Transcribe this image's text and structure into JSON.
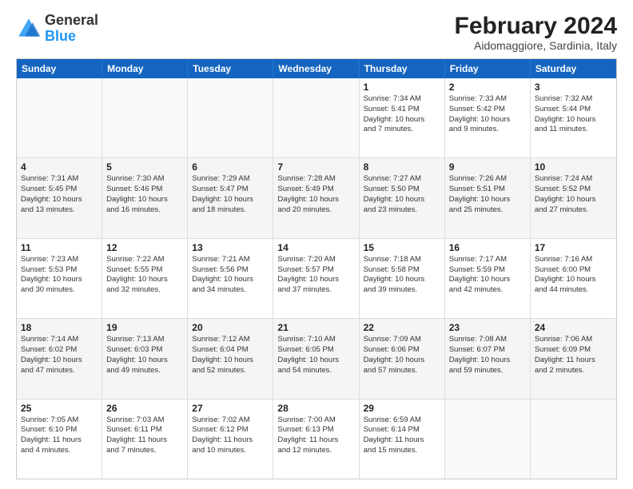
{
  "logo": {
    "general": "General",
    "blue": "Blue"
  },
  "title": "February 2024",
  "location": "Aidomaggiore, Sardinia, Italy",
  "days_of_week": [
    "Sunday",
    "Monday",
    "Tuesday",
    "Wednesday",
    "Thursday",
    "Friday",
    "Saturday"
  ],
  "weeks": [
    [
      {
        "day": "",
        "text": ""
      },
      {
        "day": "",
        "text": ""
      },
      {
        "day": "",
        "text": ""
      },
      {
        "day": "",
        "text": ""
      },
      {
        "day": "1",
        "text": "Sunrise: 7:34 AM\nSunset: 5:41 PM\nDaylight: 10 hours\nand 7 minutes."
      },
      {
        "day": "2",
        "text": "Sunrise: 7:33 AM\nSunset: 5:42 PM\nDaylight: 10 hours\nand 9 minutes."
      },
      {
        "day": "3",
        "text": "Sunrise: 7:32 AM\nSunset: 5:44 PM\nDaylight: 10 hours\nand 11 minutes."
      }
    ],
    [
      {
        "day": "4",
        "text": "Sunrise: 7:31 AM\nSunset: 5:45 PM\nDaylight: 10 hours\nand 13 minutes."
      },
      {
        "day": "5",
        "text": "Sunrise: 7:30 AM\nSunset: 5:46 PM\nDaylight: 10 hours\nand 16 minutes."
      },
      {
        "day": "6",
        "text": "Sunrise: 7:29 AM\nSunset: 5:47 PM\nDaylight: 10 hours\nand 18 minutes."
      },
      {
        "day": "7",
        "text": "Sunrise: 7:28 AM\nSunset: 5:49 PM\nDaylight: 10 hours\nand 20 minutes."
      },
      {
        "day": "8",
        "text": "Sunrise: 7:27 AM\nSunset: 5:50 PM\nDaylight: 10 hours\nand 23 minutes."
      },
      {
        "day": "9",
        "text": "Sunrise: 7:26 AM\nSunset: 5:51 PM\nDaylight: 10 hours\nand 25 minutes."
      },
      {
        "day": "10",
        "text": "Sunrise: 7:24 AM\nSunset: 5:52 PM\nDaylight: 10 hours\nand 27 minutes."
      }
    ],
    [
      {
        "day": "11",
        "text": "Sunrise: 7:23 AM\nSunset: 5:53 PM\nDaylight: 10 hours\nand 30 minutes."
      },
      {
        "day": "12",
        "text": "Sunrise: 7:22 AM\nSunset: 5:55 PM\nDaylight: 10 hours\nand 32 minutes."
      },
      {
        "day": "13",
        "text": "Sunrise: 7:21 AM\nSunset: 5:56 PM\nDaylight: 10 hours\nand 34 minutes."
      },
      {
        "day": "14",
        "text": "Sunrise: 7:20 AM\nSunset: 5:57 PM\nDaylight: 10 hours\nand 37 minutes."
      },
      {
        "day": "15",
        "text": "Sunrise: 7:18 AM\nSunset: 5:58 PM\nDaylight: 10 hours\nand 39 minutes."
      },
      {
        "day": "16",
        "text": "Sunrise: 7:17 AM\nSunset: 5:59 PM\nDaylight: 10 hours\nand 42 minutes."
      },
      {
        "day": "17",
        "text": "Sunrise: 7:16 AM\nSunset: 6:00 PM\nDaylight: 10 hours\nand 44 minutes."
      }
    ],
    [
      {
        "day": "18",
        "text": "Sunrise: 7:14 AM\nSunset: 6:02 PM\nDaylight: 10 hours\nand 47 minutes."
      },
      {
        "day": "19",
        "text": "Sunrise: 7:13 AM\nSunset: 6:03 PM\nDaylight: 10 hours\nand 49 minutes."
      },
      {
        "day": "20",
        "text": "Sunrise: 7:12 AM\nSunset: 6:04 PM\nDaylight: 10 hours\nand 52 minutes."
      },
      {
        "day": "21",
        "text": "Sunrise: 7:10 AM\nSunset: 6:05 PM\nDaylight: 10 hours\nand 54 minutes."
      },
      {
        "day": "22",
        "text": "Sunrise: 7:09 AM\nSunset: 6:06 PM\nDaylight: 10 hours\nand 57 minutes."
      },
      {
        "day": "23",
        "text": "Sunrise: 7:08 AM\nSunset: 6:07 PM\nDaylight: 10 hours\nand 59 minutes."
      },
      {
        "day": "24",
        "text": "Sunrise: 7:06 AM\nSunset: 6:09 PM\nDaylight: 11 hours\nand 2 minutes."
      }
    ],
    [
      {
        "day": "25",
        "text": "Sunrise: 7:05 AM\nSunset: 6:10 PM\nDaylight: 11 hours\nand 4 minutes."
      },
      {
        "day": "26",
        "text": "Sunrise: 7:03 AM\nSunset: 6:11 PM\nDaylight: 11 hours\nand 7 minutes."
      },
      {
        "day": "27",
        "text": "Sunrise: 7:02 AM\nSunset: 6:12 PM\nDaylight: 11 hours\nand 10 minutes."
      },
      {
        "day": "28",
        "text": "Sunrise: 7:00 AM\nSunset: 6:13 PM\nDaylight: 11 hours\nand 12 minutes."
      },
      {
        "day": "29",
        "text": "Sunrise: 6:59 AM\nSunset: 6:14 PM\nDaylight: 11 hours\nand 15 minutes."
      },
      {
        "day": "",
        "text": ""
      },
      {
        "day": "",
        "text": ""
      }
    ]
  ]
}
